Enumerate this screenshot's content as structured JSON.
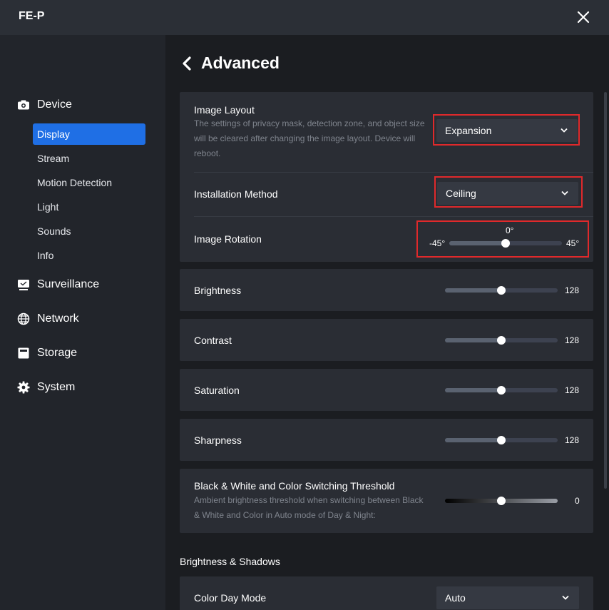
{
  "window": {
    "title": "FE-P"
  },
  "sidebar": {
    "groups": [
      {
        "label": "Device",
        "icon": "camera-icon"
      },
      {
        "label": "Surveillance",
        "icon": "monitor-icon"
      },
      {
        "label": "Network",
        "icon": "globe-icon"
      },
      {
        "label": "Storage",
        "icon": "storage-icon"
      },
      {
        "label": "System",
        "icon": "gear-icon"
      }
    ],
    "device_items": [
      "Display",
      "Stream",
      "Motion Detection",
      "Light",
      "Sounds",
      "Info"
    ],
    "active_item": "Display"
  },
  "page": {
    "title": "Advanced"
  },
  "image_layout": {
    "label": "Image Layout",
    "description": "The settings of privacy mask, detection zone, and object size will be cleared after changing the image layout. Device will reboot.",
    "value": "Expansion"
  },
  "installation_method": {
    "label": "Installation Method",
    "value": "Ceiling"
  },
  "image_rotation": {
    "label": "Image Rotation",
    "value_label": "0°",
    "min_label": "-45°",
    "max_label": "45°",
    "fraction": 0.5
  },
  "sliders": [
    {
      "label": "Brightness",
      "value": "128",
      "fraction": 0.5
    },
    {
      "label": "Contrast",
      "value": "128",
      "fraction": 0.5
    },
    {
      "label": "Saturation",
      "value": "128",
      "fraction": 0.5
    },
    {
      "label": "Sharpness",
      "value": "128",
      "fraction": 0.5
    }
  ],
  "bw_threshold": {
    "label": "Black & White and Color Switching Threshold",
    "description": "Ambient brightness threshold when switching between Black & White and Color in Auto mode of Day & Night:",
    "value": "0",
    "fraction": 0.5
  },
  "brightness_shadows": {
    "section_title": "Brightness & Shadows",
    "color_day_mode_label": "Color Day Mode",
    "color_day_mode_value": "Auto"
  },
  "colors": {
    "accent": "#1f6fe5",
    "highlight": "#e0292b"
  }
}
